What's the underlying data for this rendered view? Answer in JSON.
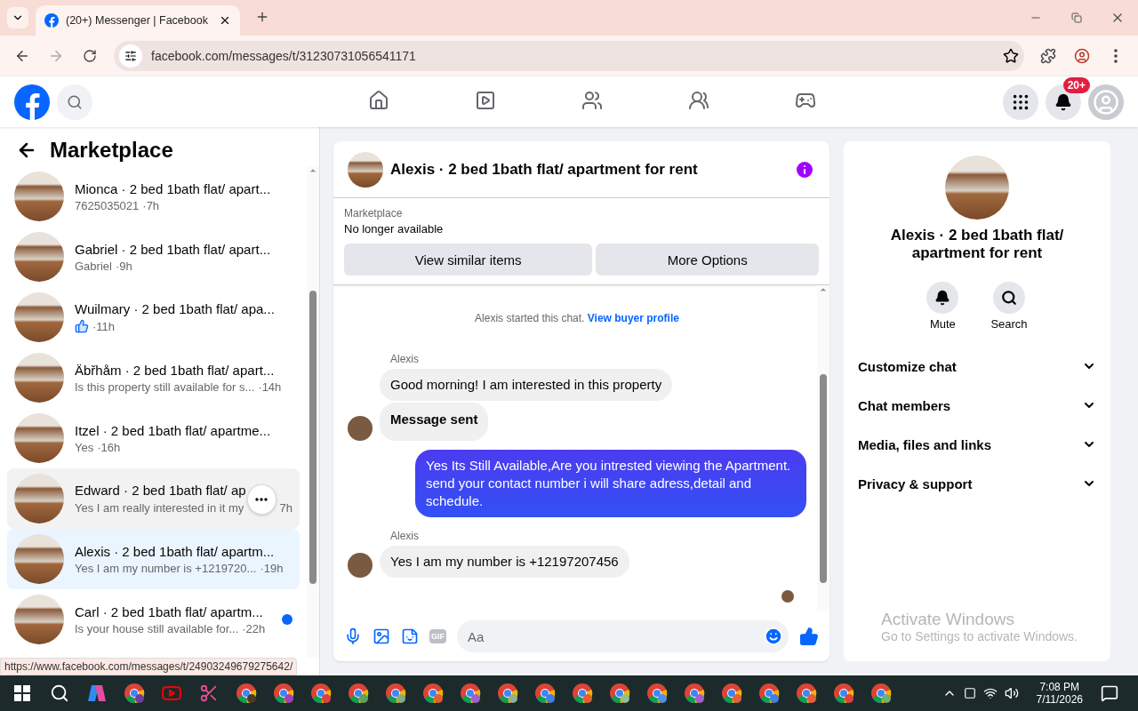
{
  "browser": {
    "tab_title": "(20+) Messenger | Facebook",
    "url": "facebook.com/messages/t/31230731056541171",
    "status_url": "https://www.facebook.com/messages/t/24903249679275642/"
  },
  "header": {
    "nav": [
      {
        "kind": "home",
        "selected": false
      },
      {
        "kind": "video",
        "selected": false
      },
      {
        "kind": "friends",
        "selected": false
      },
      {
        "kind": "groups",
        "selected": false
      },
      {
        "kind": "gaming",
        "selected": false
      }
    ],
    "notification_badge": "20+"
  },
  "sidebar": {
    "title": "Marketplace",
    "conversations": [
      {
        "title": "Mionca · 2 bed 1bath flat/ apart...",
        "preview": "7625035021",
        "time": "·7h",
        "selected": false,
        "hovered": false,
        "unread": false,
        "kind": "text"
      },
      {
        "title": "Gabriel · 2 bed 1bath flat/ apart...",
        "preview": "Gabriel",
        "time": "·9h",
        "selected": false,
        "hovered": false,
        "unread": false,
        "kind": "text"
      },
      {
        "title": "Wuilmary · 2 bed 1bath flat/ apa...",
        "time": "·11h",
        "selected": false,
        "hovered": false,
        "unread": false,
        "kind": "like"
      },
      {
        "title": "Äbřhåm · 2 bed 1bath flat/ apart...",
        "preview": "Is this property still available for s...",
        "time": "·14h",
        "selected": false,
        "hovered": false,
        "unread": false,
        "kind": "text"
      },
      {
        "title": "Itzel · 2 bed 1bath flat/ apartme...",
        "preview": "Yes",
        "time": "·16h",
        "selected": false,
        "hovered": false,
        "unread": false,
        "kind": "text"
      },
      {
        "title": "Edward · 2 bed 1bath flat/ ap",
        "preview": "Yes I am really interested in it my",
        "time": "7h",
        "selected": false,
        "hovered": true,
        "unread": false,
        "kind": "text"
      },
      {
        "title": "Alexis · 2 bed 1bath flat/ apartm...",
        "preview": "Yes I am my number is +1219720...",
        "time": "·19h",
        "selected": true,
        "hovered": false,
        "unread": false,
        "kind": "text"
      },
      {
        "title": "Carl · 2 bed 1bath flat/ apartm...",
        "preview": "Is your house still available for...",
        "time": "·22h",
        "selected": false,
        "hovered": false,
        "unread": true,
        "kind": "text"
      }
    ]
  },
  "chat": {
    "title": "Alexis · 2 bed 1bath flat/ apartment for rent",
    "listing_label": "Marketplace",
    "listing_status": "No longer available",
    "actions": [
      "View similar items",
      "More Options"
    ],
    "started_text": "Alexis started this chat.",
    "profile_link": "View buyer profile",
    "messages": [
      {
        "kind": "sender",
        "text": "Alexis"
      },
      {
        "kind": "incoming",
        "text": "Good morning! I am interested in this property",
        "avatar": false,
        "bold": false
      },
      {
        "kind": "incoming",
        "text": "Message sent",
        "avatar": true,
        "bold": true
      },
      {
        "kind": "outgoing",
        "text": "Yes Its Still Available,Are you intrested viewing the Apartment. send your contact number i will share adress,detail and schedule."
      },
      {
        "kind": "sender",
        "text": "Alexis"
      },
      {
        "kind": "incoming",
        "text": "Yes I am my number is +12197207456",
        "avatar": true,
        "bold": false
      }
    ],
    "composer": {
      "gif_label": "GIF",
      "placeholder": "Aa"
    }
  },
  "details": {
    "title": "Alexis · 2 bed 1bath flat/ apartment for rent",
    "actions": [
      {
        "kind": "mute",
        "label": "Mute"
      },
      {
        "kind": "search",
        "label": "Search"
      }
    ],
    "sections": [
      {
        "label": "Customize chat",
        "expanded": false
      },
      {
        "label": "Chat members",
        "expanded": false
      },
      {
        "label": "Media, files and links",
        "expanded": false
      },
      {
        "label": "Privacy & support",
        "expanded": false
      }
    ]
  },
  "activation": {
    "title": "Activate Windows",
    "text": "Go to Settings to activate Windows."
  },
  "taskbar": {
    "apps": [
      {
        "kind": "copilot"
      },
      {
        "kind": "chrome",
        "color": "#6b3fa0"
      },
      {
        "kind": "youtube"
      },
      {
        "kind": "snip"
      },
      {
        "kind": "chrome",
        "color": "#4a3a2a"
      },
      {
        "kind": "chrome",
        "color": "#a040c0"
      },
      {
        "kind": "chrome",
        "color": "#e04040"
      },
      {
        "kind": "chrome",
        "color": "#60a060"
      },
      {
        "kind": "chrome",
        "color": "#80b080"
      },
      {
        "kind": "chrome",
        "color": "#e06030"
      },
      {
        "kind": "chrome",
        "color": "#a060d0"
      },
      {
        "kind": "chrome",
        "color": "#90b090"
      },
      {
        "kind": "chrome",
        "color": "#4080e0"
      },
      {
        "kind": "chrome",
        "color": "#e06030"
      },
      {
        "kind": "chrome",
        "color": "#90c090"
      },
      {
        "kind": "chrome",
        "color": "#5090e0"
      },
      {
        "kind": "chrome",
        "color": "#a060d0"
      },
      {
        "kind": "chrome",
        "color": "#e06040"
      },
      {
        "kind": "chrome",
        "color": "#4080e0"
      },
      {
        "kind": "chrome",
        "color": "#e06040"
      },
      {
        "kind": "chrome",
        "color": "#e04040"
      },
      {
        "kind": "chrome",
        "color": "#70b070"
      }
    ],
    "time": "7:08 PM",
    "date": "7/11/2026"
  }
}
